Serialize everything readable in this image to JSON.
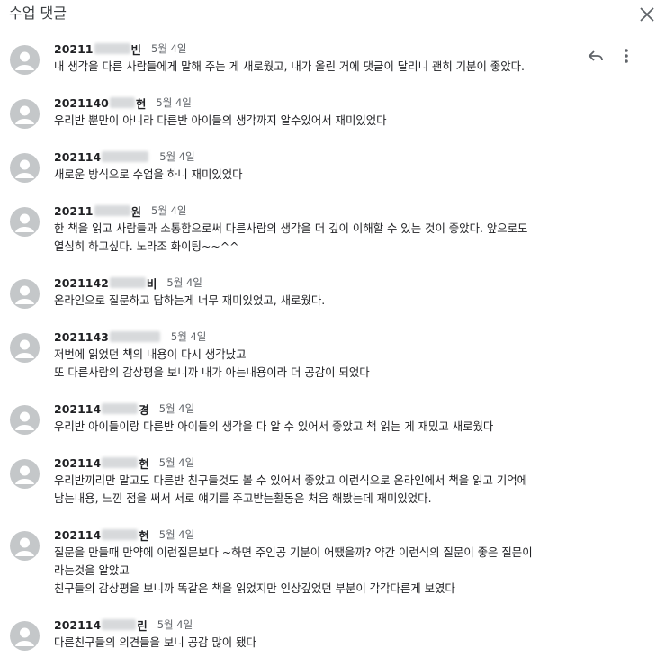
{
  "header": {
    "title": "수업 댓글"
  },
  "comments": [
    {
      "author_id": "20211",
      "author_suffix": "빈",
      "date": "5월 4일",
      "lines": [
        "내 생각을 다른 사람들에게 말해 주는 게 새로웠고, 내가 올린 거에 댓글이 달리니 괜히 기분이 좋았다."
      ]
    },
    {
      "author_id": "2021140",
      "author_suffix": "현",
      "date": "5월 4일",
      "lines": [
        "우리반 뿐만이 아니라 다른반 아이들의 생각까지 알수있어서 재미있었다"
      ]
    },
    {
      "author_id": "202114",
      "author_suffix": "",
      "date": "5월 4일",
      "lines": [
        "새로운 방식으로 수업을 하니 재미있었다"
      ]
    },
    {
      "author_id": "20211",
      "author_suffix": "원",
      "date": "5월 4일",
      "lines": [
        "한 책을 읽고 사람들과 소통함으로써 다른사람의 생각을 더 깊이 이해할 수 있는 것이 좋았다. 앞으로도",
        "열심히 하고싶다. 노라조 화이팅~~^^"
      ]
    },
    {
      "author_id": "2021142",
      "author_suffix": "비",
      "date": "5월 4일",
      "lines": [
        "온라인으로 질문하고 답하는게 너무 재미있었고, 새로웠다."
      ]
    },
    {
      "author_id": "2021143",
      "author_suffix": "",
      "date": "5월 4일",
      "lines": [
        "저번에 읽었던 책의 내용이 다시 생각났고",
        "또 다른사람의 감상평을 보니까 내가 아는내용이라 더 공감이 되었다"
      ]
    },
    {
      "author_id": "202114",
      "author_suffix": "경",
      "date": "5월 4일",
      "lines": [
        "우리반 아이들이랑 다른반 아이들의 생각을 다 알 수 있어서 좋았고 책 읽는 게 재밌고 새로웠다"
      ]
    },
    {
      "author_id": "202114",
      "author_suffix": "현",
      "date": "5월 4일",
      "lines": [
        "우리반끼리만 말고도 다른반 친구들것도 볼 수 있어서 좋았고 이런식으로 온라인에서 책을 읽고 기억에",
        "남는내용, 느낀 점을 써서 서로 얘기를 주고받는활동은 처음 해봤는데 재미있었다."
      ]
    },
    {
      "author_id": "202114",
      "author_suffix": "현",
      "date": "5월 4일",
      "lines": [
        "질문을 만들때 만약에 이런질문보다 ~하면 주인공 기분이 어땠을까? 약간 이런식의 질문이 좋은 질문이",
        "라는것을 알았고",
        "친구들의 감상평을 보니까 똑같은 책을 읽었지만 인상깊었던 부분이 각각다른게 보였다"
      ]
    },
    {
      "author_id": "202114",
      "author_suffix": "린",
      "date": "5월 4일",
      "lines": [
        "다른친구들의 의견들을 보니 공감 많이 됐다"
      ]
    }
  ],
  "icons": {
    "close": "close-icon",
    "reply": "reply-icon",
    "more": "more-vert-icon",
    "avatar": "person-icon"
  }
}
